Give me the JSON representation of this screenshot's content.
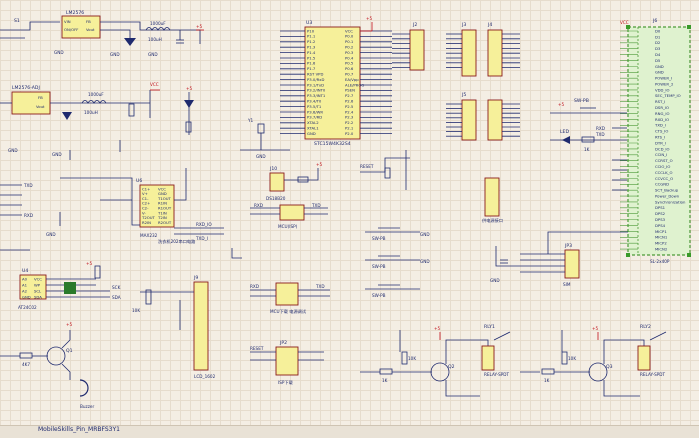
{
  "regulators": {
    "u_top_ref": "LM2576",
    "u_top_box": "ON/OFF",
    "u_top_vin": "VIN",
    "u_top_fb": "FB",
    "u_top_vout": "Vout",
    "u_mid_ref": "LM2576-ADJ",
    "u_mid_fb": "FB",
    "u_mid_vout": "Vout",
    "c_top": "1000uF",
    "l_top": "100uH",
    "c_mid": "1000uF",
    "l_mid": "100uH"
  },
  "mcu": {
    "ref": "U3",
    "name": "STC15W4K32S4",
    "left_pins": [
      "P10",
      "P1.1",
      "P1.2",
      "P1.3",
      "P1.4",
      "P1.5",
      "P1.6",
      "P1.7",
      "RST VPD",
      "P3.0/RxD",
      "P3.1/TxD",
      "P3.2/INT0",
      "P3.3/INT1",
      "P3.4/T0",
      "P3.5/T1",
      "P3.6/WR",
      "P3.7/RD",
      "XTAL2",
      "XTAL1",
      "GND"
    ],
    "right_pins": [
      "VCC",
      "P0.0",
      "P0.1",
      "P0.2",
      "P0.3",
      "P0.4",
      "P0.5",
      "P0.6",
      "P0.7",
      "EA/Vpp",
      "ALE/PROG",
      "PSEN",
      "P2.7",
      "P2.6",
      "P2.5",
      "P2.4",
      "P2.3",
      "P2.2",
      "P2.1",
      "P2.0"
    ],
    "crystal": "Y1"
  },
  "big_connector": {
    "ref": "J6",
    "name": "SL-2x40P",
    "pins": [
      "D0",
      "D1",
      "D2",
      "D3",
      "D4",
      "D5",
      "GND",
      "GND",
      "POWER_I",
      "POWER_2",
      "VDD_IO",
      "SEC_TEMP_IO",
      "RST_I",
      "DSR_IO",
      "RNG_IO",
      "RXD_IO",
      "TXD_I",
      "CTS_IO",
      "RTS_I",
      "DTR_I",
      "DCD_IO",
      "CCIN_I",
      "CCRST_O",
      "CCIO_IO",
      "CCCLK_O",
      "CCVCC_O",
      "CCGND",
      "SCT_Backup",
      "Power_Down",
      "Synchronization",
      "DPS1",
      "DPS2",
      "DPS3",
      "DPS4",
      "MICP1",
      "MICN1",
      "MICP2",
      "MICN2"
    ]
  },
  "serial": {
    "ref": "U6",
    "name": "MAX232",
    "caption": "洗衣机202串口电路",
    "pins_left": [
      "C1+",
      "V+",
      "C1-",
      "C2+",
      "C2-",
      "V-",
      "T2OUT",
      "R2IN"
    ],
    "pins_right": [
      "VCC",
      "GND",
      "T1OUT",
      "R1IN",
      "R1OUT",
      "T1IN",
      "T2IN",
      "R2OUT"
    ],
    "net_rxd": "RXD_IO",
    "net_txd": "TXD_I"
  },
  "headers": {
    "j2": "J2",
    "j3": "J3",
    "j4": "J4",
    "j5": "J5",
    "j9_ref": "J9",
    "j9_name": "LCD_1602",
    "j11_caption": "供电源接口",
    "jp1_caption": "MCU下载 电源调试",
    "jp2_ref": "JP2",
    "jp2_caption": "ISP下载",
    "jp3_ref": "JP3",
    "jp3_name": "SIM",
    "j10_ref": "J10",
    "j10_name": "DS18B20"
  },
  "aux": {
    "u4_ref": "U4",
    "u4_name": "AT24C02",
    "u4_pins": [
      "A0",
      "A1",
      "A2",
      "GND",
      "VCC",
      "WP",
      "SCL",
      "SDA"
    ],
    "sw_s1": "S1",
    "sw_s6": "SW-PB",
    "sw_s7": "SW-PB",
    "sw_s8": "SW-PB",
    "sw_s9": "SW-PB",
    "sw_s10": "SW-PB",
    "led_d4": "LED",
    "r13": "1K",
    "mcu_name_small": "MCU(ISP)",
    "relay1": "RELAY-SPDT",
    "relay2": "RELAY-SPDT",
    "rly1_ref": "RLY1",
    "rly2_ref": "RLY2",
    "q1": "Q1",
    "q2": "Q2",
    "q3": "Q3",
    "buzzer": "Buzzer",
    "r_10k": "10K",
    "r_4k7": "4K7",
    "vcc": "VCC",
    "gnd": "GND",
    "plus5": "+5",
    "net_reset": "RESET",
    "net_txd": "TXD",
    "net_rxd": "RXD",
    "net_sck": "SCK",
    "net_sda": "SDA"
  },
  "footer": {
    "text": "MobileSkills_Pin_MRBFS3Y1"
  }
}
